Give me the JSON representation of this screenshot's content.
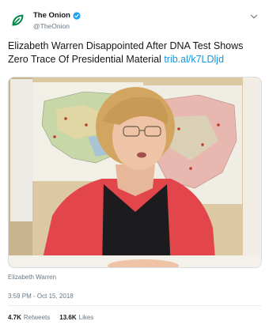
{
  "header": {
    "display_name": "The Onion",
    "handle": "@TheOnion",
    "avatar_icon": "onion-leaf-icon",
    "verified_icon": "verified-badge-icon",
    "menu_icon": "chevron-down-icon"
  },
  "tweet": {
    "text": "Elizabeth Warren Disappointed After DNA Test Shows Zero Trace Of Presidential Material",
    "link": "trib.al/k7LDljd"
  },
  "media": {
    "caption": "Elizabeth Warren"
  },
  "meta": {
    "timestamp": "3:59 PM - Oct 15, 2018"
  },
  "stats": {
    "retweets_count": "4.7K",
    "retweets_label": "Retweets",
    "likes_count": "13.6K",
    "likes_label": "Likes"
  },
  "colors": {
    "brand_green": "#00854a",
    "verified_blue": "#1da1f2",
    "link_blue": "#1b95e0"
  }
}
